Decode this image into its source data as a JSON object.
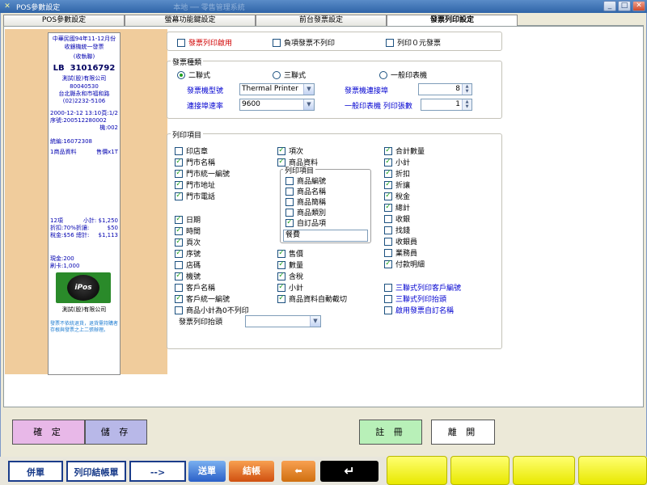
{
  "window": {
    "title": "POS參數設定",
    "background_title": "本地 ── 零售管理系統"
  },
  "tabs": [
    {
      "label": "POS參數設定"
    },
    {
      "label": "螢幕功能鍵設定"
    },
    {
      "label": "前台發票設定"
    },
    {
      "label": "發票列印設定",
      "active": true
    }
  ],
  "receipt": {
    "header1": "中華民國94年11-12月份",
    "header2": "收銀機統一發票",
    "header3": "(收執聯)",
    "lb_prefix": "LB",
    "invoice_no": "31016792",
    "company": "測試(股)有限公司",
    "tax_id": "80040530",
    "address": "台北縣永和市福和路",
    "phone": "(02)2232-5106",
    "datetime": "2000-12-12 13:10",
    "page": "頁:1/2",
    "serial": "序號:200512280002",
    "machine": "機:002",
    "tax_no": "統編:16072308",
    "item": "1商品資料",
    "item_price": "售價x1T",
    "count": "12項",
    "subtotal_label": "小計:",
    "subtotal": "$1,250",
    "discount_label": "折扣:70%折讓:",
    "discount": "$50",
    "tax_label": "稅金:$56 總計:",
    "total": "$1,113",
    "cash": "現金:200",
    "card": "刷卡:1,000",
    "logo_text": "iPos",
    "footer_company": "測試(股)有限公司",
    "footer_note": "發票不依統退貨，退貨需持購者存根與發票之上二張辦理。"
  },
  "top_options": {
    "invoice_enable": "發票列印啟用",
    "negative_no_print": "負項發票不列印",
    "zero_invoice_print": "列印０元發票"
  },
  "invoice_type": {
    "legend": "發票種類",
    "radio_two": "二聯式",
    "radio_three": "三聯式",
    "radio_general": "一般印表機",
    "machine_type_label": "發票機型號",
    "machine_type_value": "Thermal Printer",
    "port_label": "發票機連接埠",
    "port_value": "8",
    "baud_label": "連接埠速率",
    "baud_value": "9600",
    "copies_label": "一般印表機 列印張數",
    "copies_value": "1"
  },
  "print_items": {
    "legend": "列印項目",
    "col1a": [
      {
        "label": "印店章",
        "checked": false
      },
      {
        "label": "門市名稱",
        "checked": true
      },
      {
        "label": "門市統一編號",
        "checked": true
      },
      {
        "label": "門市地址",
        "checked": true
      },
      {
        "label": "門市電話",
        "checked": true
      }
    ],
    "col1b": [
      {
        "label": "日期",
        "checked": true
      },
      {
        "label": "時間",
        "checked": true
      },
      {
        "label": "頁次",
        "checked": true
      },
      {
        "label": "序號",
        "checked": true
      },
      {
        "label": "店碼",
        "checked": false
      },
      {
        "label": "機號",
        "checked": true
      },
      {
        "label": "客戶名稱",
        "checked": false
      },
      {
        "label": "客戶統一編號",
        "checked": true
      },
      {
        "label": "商品小計為0不列印",
        "checked": false
      }
    ],
    "invoice_title_label": "發票列印抬頭",
    "invoice_title_value": "",
    "col2a": [
      {
        "label": "項次",
        "checked": true
      },
      {
        "label": "商品資料",
        "checked": true
      }
    ],
    "sub_legend": "列印項目",
    "sub": [
      {
        "label": "商品編號",
        "checked": false
      },
      {
        "label": "商品名稱",
        "checked": false
      },
      {
        "label": "商品簡稱",
        "checked": false
      },
      {
        "label": "商品類別",
        "checked": false
      },
      {
        "label": "自訂品項",
        "checked": true
      }
    ],
    "custom_item_value": "餐費",
    "col2b": [
      {
        "label": "售價",
        "checked": true
      },
      {
        "label": "數量",
        "checked": true
      },
      {
        "label": "含稅",
        "checked": true
      },
      {
        "label": "小計",
        "checked": true
      },
      {
        "label": "商品資料自動截切",
        "checked": true
      }
    ],
    "col3": [
      {
        "label": "合計數量",
        "checked": true
      },
      {
        "label": "小計",
        "checked": true
      },
      {
        "label": "折扣",
        "checked": true
      },
      {
        "label": "折讓",
        "checked": true
      },
      {
        "label": "稅金",
        "checked": true
      },
      {
        "label": "總計",
        "checked": true
      },
      {
        "label": "收銀",
        "checked": false
      },
      {
        "label": "找錢",
        "checked": false
      },
      {
        "label": "收銀員",
        "checked": false
      },
      {
        "label": "業務員",
        "checked": false
      },
      {
        "label": "付款明細",
        "checked": true
      }
    ],
    "col3b": [
      {
        "label": "三聯式列印客戶編號",
        "checked": false
      },
      {
        "label": "三聯式列印抬頭",
        "checked": false
      },
      {
        "label": "啟用發票自訂名稱",
        "checked": false
      }
    ]
  },
  "buttons": {
    "confirm": "確 定",
    "save": "儲 存",
    "register": "註 冊",
    "leave": "離 開"
  },
  "bottom_bar": {
    "merge": "併單",
    "print_bill": "列印結帳單",
    "next": "-->",
    "send": "送單",
    "checkout": "結帳"
  },
  "colors": {
    "confirm_bg": "#e8b8e8",
    "save_bg": "#b8b8e8",
    "register_bg": "#b8f0b8",
    "leave_bg": "#ffffff",
    "receipt_bg": "#f0cc9c",
    "yellow": "#f0f000"
  }
}
